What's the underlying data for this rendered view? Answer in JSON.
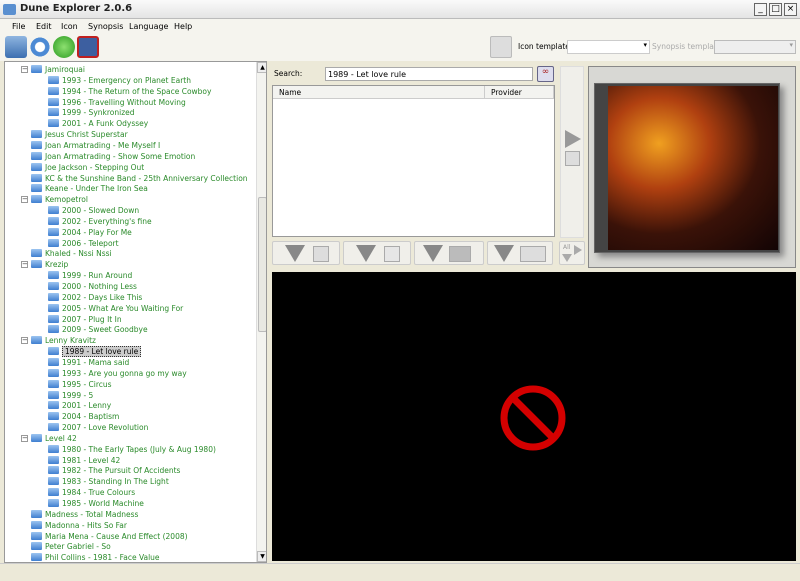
{
  "window": {
    "title": "Dune Explorer 2.0.6"
  },
  "menu": [
    "File",
    "Edit",
    "Icon",
    "Synopsis",
    "Language",
    "Help"
  ],
  "toolbar": {
    "icon_template_label": "Icon template",
    "icon_template_value": "",
    "synopsis_template_label": "Synopsis template",
    "synopsis_template_value": ""
  },
  "search": {
    "label": "Search:",
    "value": "1989 - Let love rule"
  },
  "list": {
    "columns": [
      "Name",
      "Provider"
    ]
  },
  "side": {
    "all_label": "All"
  },
  "tree": [
    {
      "t": "Jamiroquai",
      "l": 1,
      "e": true
    },
    {
      "t": "1993 - Emergency on Planet Earth",
      "l": 2
    },
    {
      "t": "1994 - The Return of the Space Cowboy",
      "l": 2
    },
    {
      "t": "1996 - Travelling Without Moving",
      "l": 2
    },
    {
      "t": "1999 - Synkronized",
      "l": 2
    },
    {
      "t": "2001 - A Funk Odyssey",
      "l": 2
    },
    {
      "t": "Jesus Christ Superstar",
      "l": 1
    },
    {
      "t": "Joan Armatrading - Me Myself I",
      "l": 1
    },
    {
      "t": "Joan Armatrading - Show Some Emotion",
      "l": 1
    },
    {
      "t": "Joe Jackson - Stepping Out",
      "l": 1
    },
    {
      "t": "KC & the Sunshine Band - 25th Anniversary Collection",
      "l": 1
    },
    {
      "t": "Keane - Under The Iron Sea",
      "l": 1
    },
    {
      "t": "Kemopetrol",
      "l": 1,
      "e": true
    },
    {
      "t": "2000 - Slowed Down",
      "l": 2
    },
    {
      "t": "2002 - Everything's fine",
      "l": 2
    },
    {
      "t": "2004 - Play For Me",
      "l": 2
    },
    {
      "t": "2006 - Teleport",
      "l": 2
    },
    {
      "t": "Khaled - Nssi Nssi",
      "l": 1
    },
    {
      "t": "Krezip",
      "l": 1,
      "e": true
    },
    {
      "t": "1999 - Run Around",
      "l": 2
    },
    {
      "t": "2000 - Nothing Less",
      "l": 2
    },
    {
      "t": "2002 - Days Like This",
      "l": 2
    },
    {
      "t": "2005 - What Are You Waiting For",
      "l": 2
    },
    {
      "t": "2007 - Plug It In",
      "l": 2
    },
    {
      "t": "2009 - Sweet Goodbye",
      "l": 2
    },
    {
      "t": "Lenny Kravitz",
      "l": 1,
      "e": true
    },
    {
      "t": "1989 - Let love rule",
      "l": 2,
      "s": true
    },
    {
      "t": "1991 - Mama said",
      "l": 2
    },
    {
      "t": "1993 - Are you gonna go my way",
      "l": 2
    },
    {
      "t": "1995 - Circus",
      "l": 2
    },
    {
      "t": "1999 - 5",
      "l": 2
    },
    {
      "t": "2001 - Lenny",
      "l": 2
    },
    {
      "t": "2004 - Baptism",
      "l": 2
    },
    {
      "t": "2007 - Love Revolution",
      "l": 2
    },
    {
      "t": "Level 42",
      "l": 1,
      "e": true
    },
    {
      "t": "1980 - The Early Tapes (July & Aug 1980)",
      "l": 2
    },
    {
      "t": "1981 - Level 42",
      "l": 2
    },
    {
      "t": "1982 - The Pursuit Of Accidents",
      "l": 2
    },
    {
      "t": "1983 - Standing In The Light",
      "l": 2
    },
    {
      "t": "1984 - True Colours",
      "l": 2
    },
    {
      "t": "1985 - World Machine",
      "l": 2
    },
    {
      "t": "Madness - Total Madness",
      "l": 1
    },
    {
      "t": "Madonna - Hits So Far",
      "l": 1
    },
    {
      "t": "Maria Mena - Cause And Effect (2008)",
      "l": 1
    },
    {
      "t": "Peter Gabriel - So",
      "l": 1
    },
    {
      "t": "Phil Collins - 1981 - Face Value",
      "l": 1
    }
  ],
  "colors": {
    "tree_text": "#2a8a2a",
    "no_symbol": "#d40000"
  }
}
